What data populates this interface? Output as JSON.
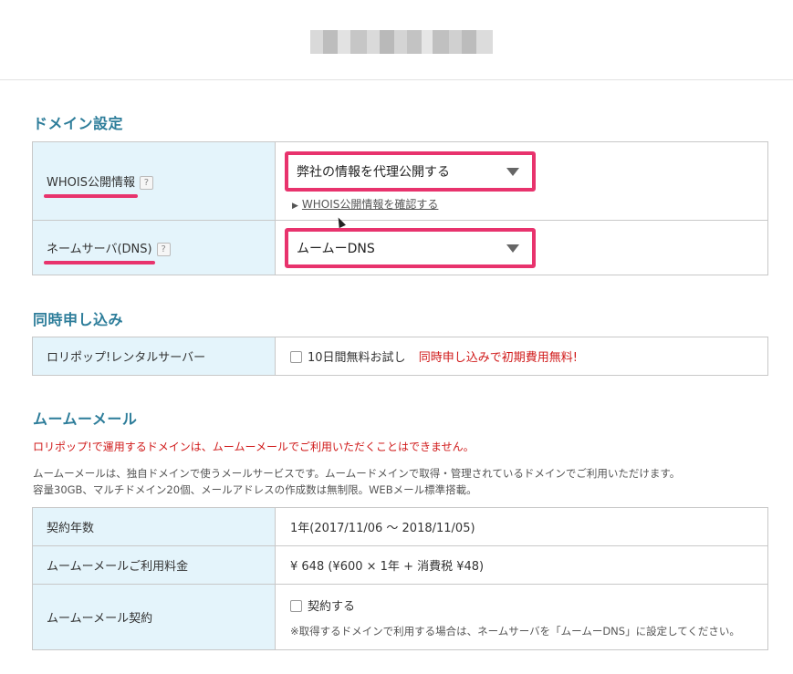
{
  "domain_settings": {
    "title": "ドメイン設定",
    "whois": {
      "label": "WHOIS公開情報",
      "help": "?",
      "selected": "弊社の情報を代理公開する",
      "link_text": "WHOIS公開情報を確認する"
    },
    "nameserver": {
      "label": "ネームサーバ(DNS)",
      "help": "?",
      "selected": "ムームーDNS"
    }
  },
  "simultaneous": {
    "title": "同時申し込み",
    "row_label": "ロリポップ!レンタルサーバー",
    "checkbox_label": "10日間無料お試し",
    "promo": "同時申し込みで初期費用無料!"
  },
  "mail": {
    "title": "ムームーメール",
    "warning": "ロリポップ!で運用するドメインは、ムームーメールでご利用いただくことはできません。",
    "desc1": "ムームーメールは、独自ドメインで使うメールサービスです。ムームードメインで取得・管理されているドメインでご利用いただけます。",
    "desc2": "容量30GB、マルチドメイン20個、メールアドレスの作成数は無制限。WEBメール標準搭載。",
    "rows": {
      "term_label": "契約年数",
      "term_value": "1年(2017/11/06 〜 2018/11/05)",
      "fee_label": "ムームーメールご利用料金",
      "fee_value": "¥ 648 (¥600 × 1年 + 消費税 ¥48)",
      "contract_label": "ムームーメール契約",
      "contract_checkbox": "契約する",
      "contract_note": "※取得するドメインで利用する場合は、ネームサーバを「ムームーDNS」に設定してください。"
    }
  },
  "colors": {
    "accent_title": "#2d7d9a",
    "highlight": "#e8336d",
    "label_bg": "#e4f4fb",
    "warning": "#d01a1a"
  }
}
